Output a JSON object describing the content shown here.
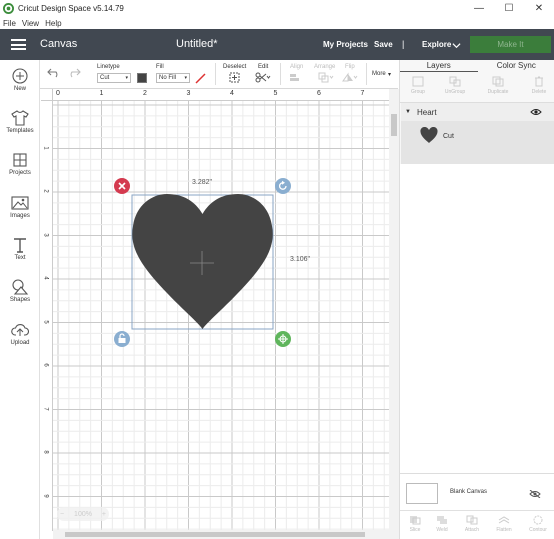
{
  "window": {
    "title": "Cricut Design Space  v5.14.79",
    "minimize": "—",
    "maximize": "☐",
    "close": "✕"
  },
  "menu": [
    "File",
    "View",
    "Help"
  ],
  "header": {
    "section": "Canvas",
    "doc_title": "Untitled*",
    "my_projects": "My Projects",
    "save": "Save",
    "separator": "|",
    "explore": "Explore",
    "make_it": "Make It",
    "colors": {
      "bg": "#414851",
      "make_it": "#3b7d3b"
    }
  },
  "toolbar": {
    "linetype_label": "Linetype",
    "linetype_value": "Cut",
    "fill_label": "Fill",
    "fill_value": "No Fill",
    "deselect_label": "Deselect",
    "edit_label": "Edit",
    "align_label": "Align",
    "arrange_label": "Arrange",
    "flip_label": "Flip",
    "more_label": "More",
    "more_chev": "▾"
  },
  "leftbar": [
    {
      "label": "New",
      "icon": "plus-circle-icon"
    },
    {
      "label": "Templates",
      "icon": "shirt-icon"
    },
    {
      "label": "Projects",
      "icon": "projects-icon"
    },
    {
      "label": "Images",
      "icon": "image-icon"
    },
    {
      "label": "Text",
      "icon": "text-icon"
    },
    {
      "label": "Shapes",
      "icon": "shapes-icon"
    },
    {
      "label": "Upload",
      "icon": "upload-icon"
    }
  ],
  "rulers": {
    "horizontal": [
      "0",
      "1",
      "2",
      "3",
      "4",
      "5",
      "6",
      "7"
    ],
    "vertical": [
      "1",
      "2",
      "3",
      "4",
      "5",
      "6",
      "7",
      "8",
      "9"
    ]
  },
  "selection": {
    "width": "3.282\"",
    "height": "3.106\"",
    "shape_color": "#444444"
  },
  "zoom": {
    "minus": "−",
    "value": "100%",
    "plus": "+"
  },
  "panel": {
    "tabs": [
      "Layers",
      "Color Sync"
    ],
    "actions": [
      "Group",
      "UnGroup",
      "Duplicate",
      "Delete"
    ],
    "layer_group": "Heart",
    "layer_item": "Cut",
    "blank_canvas": "Blank Canvas",
    "bottom_actions": [
      "Slice",
      "Weld",
      "Attach",
      "Flatten",
      "Contour"
    ]
  }
}
